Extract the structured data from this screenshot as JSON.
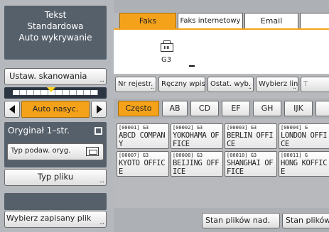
{
  "left": {
    "status_lines": [
      "Tekst",
      "Standardowa",
      "Auto wykrywanie"
    ],
    "scan_button": "Ustaw. skanowania",
    "density_auto": "Auto nasyc.",
    "orig_label": "Oryginał 1–str.",
    "typ_podaw": "Typ podaw. oryg.",
    "typ_pliku": "Typ pliku",
    "wybierz_plik": "Wybierz zapisany plik"
  },
  "tabs": [
    "Faks",
    "Faks internetowy",
    "Email",
    ""
  ],
  "panel": {
    "line_type": "G3"
  },
  "row1": [
    "Nr rejestr.",
    "Ręczny wpis",
    "Ostat. wyb.",
    "Wybierz lin.",
    "T"
  ],
  "index_tabs": [
    "Często",
    "AB",
    "CD",
    "EF",
    "GH",
    "IJK",
    ""
  ],
  "destinations": [
    {
      "code": "[00001] G3",
      "name": "ABCD COMPANY"
    },
    {
      "code": "[00002] G3",
      "name": "YOKOHAMA OFFICE"
    },
    {
      "code": "[00003] G3",
      "name": "BERLIN OFFICE"
    },
    {
      "code": "[00004] G",
      "name": "LONDON OFFICE"
    },
    {
      "code": "[00007] G3",
      "name": "KYOTO OFFICE"
    },
    {
      "code": "[00008] G3",
      "name": "BEIJING OFFICE"
    },
    {
      "code": "[00010] G3",
      "name": "SHANGHAI OFFICE"
    },
    {
      "code": "[00011] G",
      "name": "HONG KOFFICE"
    }
  ],
  "bottom": [
    "Stan plików nad.",
    "Stan plików"
  ],
  "colors": {
    "accent": "#f5a21b",
    "dark_panel": "#56606b"
  }
}
